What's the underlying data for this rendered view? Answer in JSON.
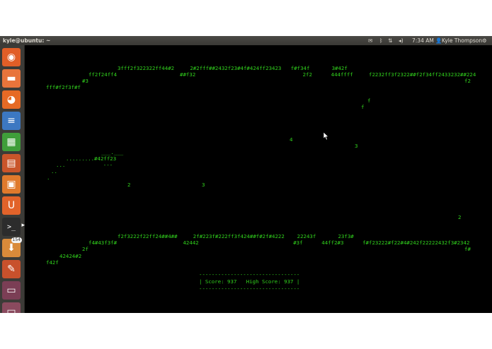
{
  "panel": {
    "window_title": "kyle@ubuntu: ~",
    "icons": [
      "mail-icon",
      "bluetooth-icon",
      "network-icon",
      "volume-icon"
    ],
    "time": "7:34 AM",
    "user": "Kyle Thompson",
    "glyphs": {
      "mail": "✉",
      "bluetooth": "ᛒ",
      "network": "⇅",
      "volume": "◂)",
      "user": "👤",
      "power": "⚙"
    }
  },
  "launcher": {
    "items": [
      {
        "name": "dash-home",
        "glyph": "◉",
        "bg": "#e15e27"
      },
      {
        "name": "files",
        "glyph": "▬",
        "bg": "#e8743b"
      },
      {
        "name": "firefox",
        "glyph": "◕",
        "bg": "#e66a25"
      },
      {
        "name": "libreoffice-writer",
        "glyph": "≡",
        "bg": "#3c78c2"
      },
      {
        "name": "libreoffice-calc",
        "glyph": "▦",
        "bg": "#3f9e3a"
      },
      {
        "name": "libreoffice-impress",
        "glyph": "▤",
        "bg": "#c9552a"
      },
      {
        "name": "software-center",
        "glyph": "▣",
        "bg": "#e07a2c"
      },
      {
        "name": "ubuntu-one",
        "glyph": "U",
        "bg": "#e2632a"
      },
      {
        "name": "terminal",
        "glyph": ">_",
        "bg": "#2c2c2c"
      },
      {
        "name": "update-manager",
        "glyph": "⬇",
        "bg": "#d98a3a",
        "badge": "154"
      },
      {
        "name": "system-settings",
        "glyph": "✎",
        "bg": "#c8512c"
      },
      {
        "name": "workspace-switcher",
        "glyph": "▭",
        "bg": "#7b3e55"
      },
      {
        "name": "trash",
        "glyph": "▭",
        "bg": "#8a4a5e"
      }
    ]
  },
  "game": {
    "color": "#31d21d",
    "lines": [
      "3fff2f322322ff44#2     2#2fff##2432f23#4f#424ff23423   f#f34f       3#42f",
      "ff2f24ff4                    ##f32                                  2f2      444ffff     f2232ff3f2322##f2f34ff2433232##224",
      "#3",
      "f2",
      "fff#f2f3f#f",
      "f",
      "f",
      "4",
      "3",
      "___.___",
      ".........#42ff23",
      "...            ---",
      "..",
      ".",
      "2",
      "3",
      "2",
      "f2f3222f22ff24##4##     2f#223f#222ff3f424##f#2f#4222    22243f       23f3#",
      "f4#43f3f#                     42442                              #3f      44ff2#3      f#f23222#f22#4#242f22222432f3#2342",
      "2f",
      "f#",
      "42424#2",
      "f42f"
    ],
    "score_box": {
      "border": "--------------------------------",
      "text": "| Score: 937   High Score: 937 |"
    }
  }
}
